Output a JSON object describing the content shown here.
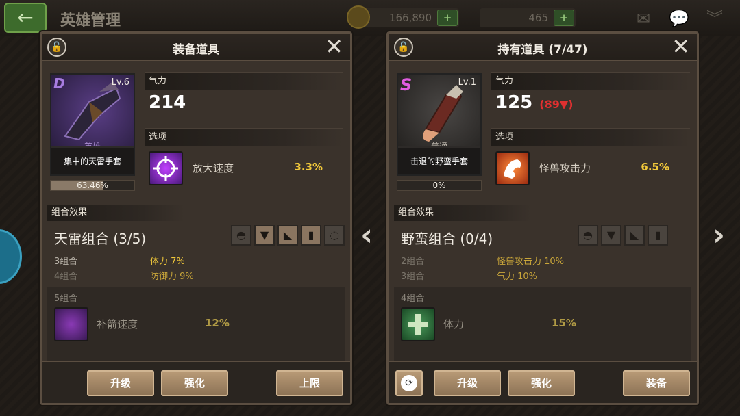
{
  "topbar": {
    "back": "←",
    "title": "英雄管理",
    "gold": "166,890",
    "gems": "465",
    "plus": "+"
  },
  "left": {
    "title": "装备道具",
    "item": {
      "grade": "D",
      "level": "Lv.6",
      "rarity": "英雄",
      "name": "集中的天雷手套",
      "progress": "63.46%",
      "progress_value": 63.46
    },
    "stat": {
      "label": "气力",
      "value": "214"
    },
    "option": {
      "label": "选项",
      "name": "放大速度",
      "value": "3.3%"
    },
    "set": {
      "header": "组合效果",
      "name": "天雷组合 (3/5)",
      "bonuses": [
        {
          "count": "3组合",
          "effect": "体力 7%"
        },
        {
          "count": "4组合",
          "effect": "防御力 9%"
        }
      ],
      "locked": {
        "count": "5组合",
        "name": "补箭速度",
        "value": "12%"
      }
    },
    "buttons": {
      "upgrade": "升级",
      "enhance": "强化",
      "limit": "上限"
    }
  },
  "right": {
    "title": "持有道具 (7/47)",
    "item": {
      "grade": "S",
      "level": "Lv.1",
      "rarity": "普通",
      "name": "击退的野蛮手套",
      "progress": "0%",
      "progress_value": 0
    },
    "stat": {
      "label": "气力",
      "value": "125",
      "diff": "(89▼)"
    },
    "option": {
      "label": "选项",
      "name": "怪兽攻击力",
      "value": "6.5%"
    },
    "set": {
      "header": "组合效果",
      "name": "野蛮组合 (0/4)",
      "bonuses": [
        {
          "count": "2组合",
          "effect": "怪兽攻击力 10%"
        },
        {
          "count": "3组合",
          "effect": "气力 10%"
        }
      ],
      "locked": {
        "count": "4组合",
        "name": "体力",
        "value": "15%"
      }
    },
    "buttons": {
      "upgrade": "升级",
      "enhance": "强化",
      "equip": "装备"
    }
  },
  "nav": {
    "prev": "‹",
    "next": "›"
  },
  "colors": {
    "accent_yellow": "#f2c93a",
    "down_red": "#e03030",
    "button": "#a88a68"
  }
}
